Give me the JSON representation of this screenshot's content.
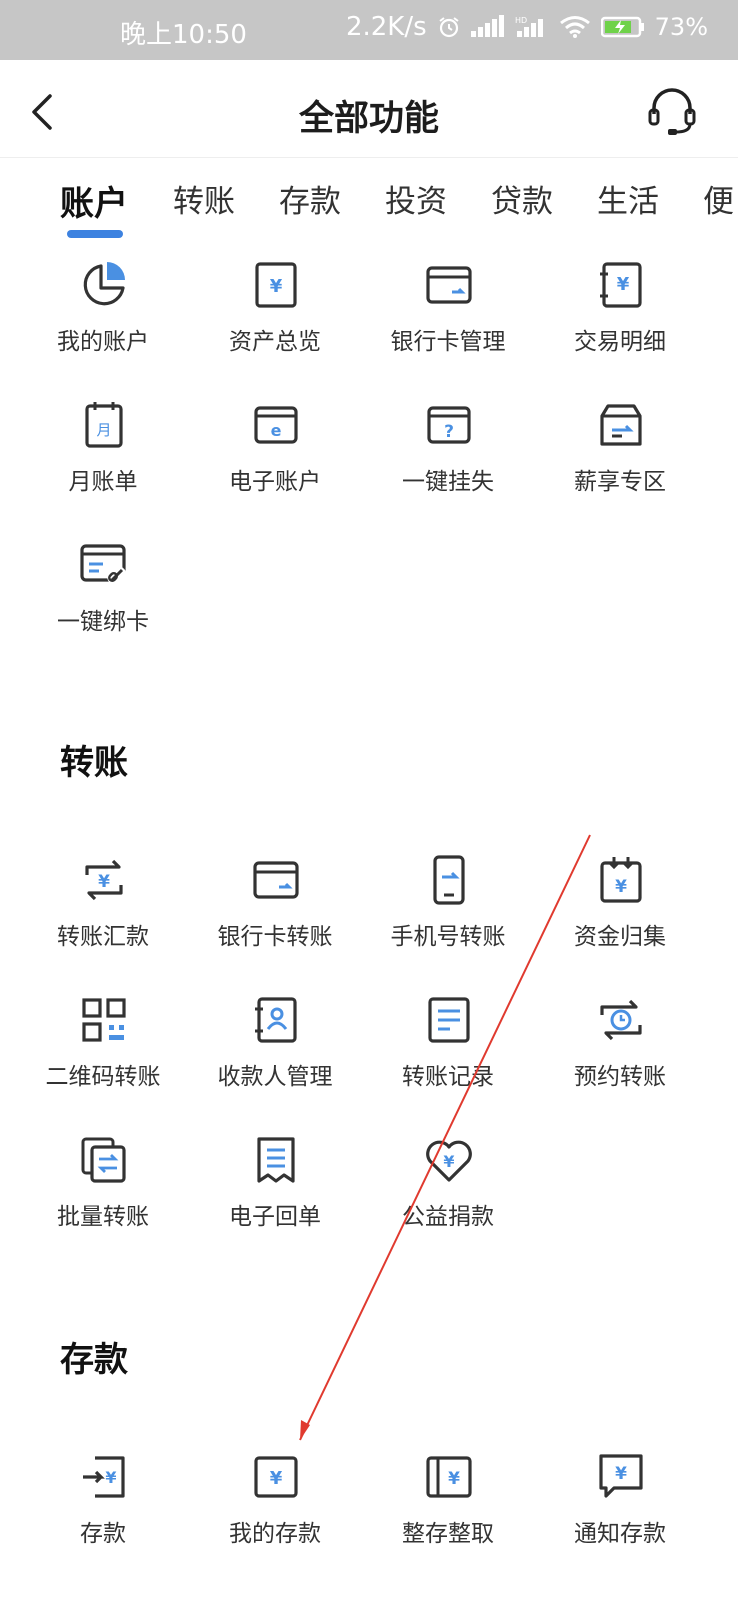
{
  "status_bar": {
    "time": "晚上10:50",
    "speed": "2.2K/s",
    "battery": "73%"
  },
  "header": {
    "title": "全部功能",
    "back_icon": "back-arrow-icon",
    "service_icon": "headset-icon"
  },
  "tabs": [
    {
      "label": "账户",
      "active": true
    },
    {
      "label": "转账"
    },
    {
      "label": "存款"
    },
    {
      "label": "投资"
    },
    {
      "label": "贷款"
    },
    {
      "label": "生活"
    },
    {
      "label": "便"
    }
  ],
  "account": {
    "items": [
      {
        "label": "我的账户",
        "icon": "pie-chart-icon"
      },
      {
        "label": "资产总览",
        "icon": "yuan-document-icon"
      },
      {
        "label": "银行卡管理",
        "icon": "bank-card-icon"
      },
      {
        "label": "交易明细",
        "icon": "yuan-notebook-icon"
      },
      {
        "label": "月账单",
        "icon": "calendar-month-icon"
      },
      {
        "label": "电子账户",
        "icon": "e-card-icon"
      },
      {
        "label": "一键挂失",
        "icon": "question-card-icon"
      },
      {
        "label": "薪享专区",
        "icon": "salary-box-icon"
      },
      {
        "label": "一键绑卡",
        "icon": "card-link-icon"
      }
    ]
  },
  "transfer": {
    "title": "转账",
    "items": [
      {
        "label": "转账汇款",
        "icon": "transfer-cycle-icon"
      },
      {
        "label": "银行卡转账",
        "icon": "bank-card-icon"
      },
      {
        "label": "手机号转账",
        "icon": "phone-icon"
      },
      {
        "label": "资金归集",
        "icon": "fund-collect-icon"
      },
      {
        "label": "二维码转账",
        "icon": "qr-code-icon"
      },
      {
        "label": "收款人管理",
        "icon": "contact-book-icon"
      },
      {
        "label": "转账记录",
        "icon": "record-list-icon"
      },
      {
        "label": "预约转账",
        "icon": "scheduled-transfer-icon"
      },
      {
        "label": "批量转账",
        "icon": "batch-transfer-icon"
      },
      {
        "label": "电子回单",
        "icon": "receipt-icon"
      },
      {
        "label": "公益捐款",
        "icon": "heart-yuan-icon"
      }
    ]
  },
  "deposit": {
    "title": "存款",
    "items": [
      {
        "label": "存款",
        "icon": "deposit-in-icon"
      },
      {
        "label": "我的存款",
        "icon": "yuan-document-icon"
      },
      {
        "label": "整存整取",
        "icon": "yuan-book-icon"
      },
      {
        "label": "通知存款",
        "icon": "notice-bubble-icon"
      }
    ]
  },
  "colors": {
    "accent": "#3d82e0",
    "icon_blue": "#4a90e2",
    "icon_dark": "#333333",
    "annotation_arrow": "#e03a2f"
  }
}
